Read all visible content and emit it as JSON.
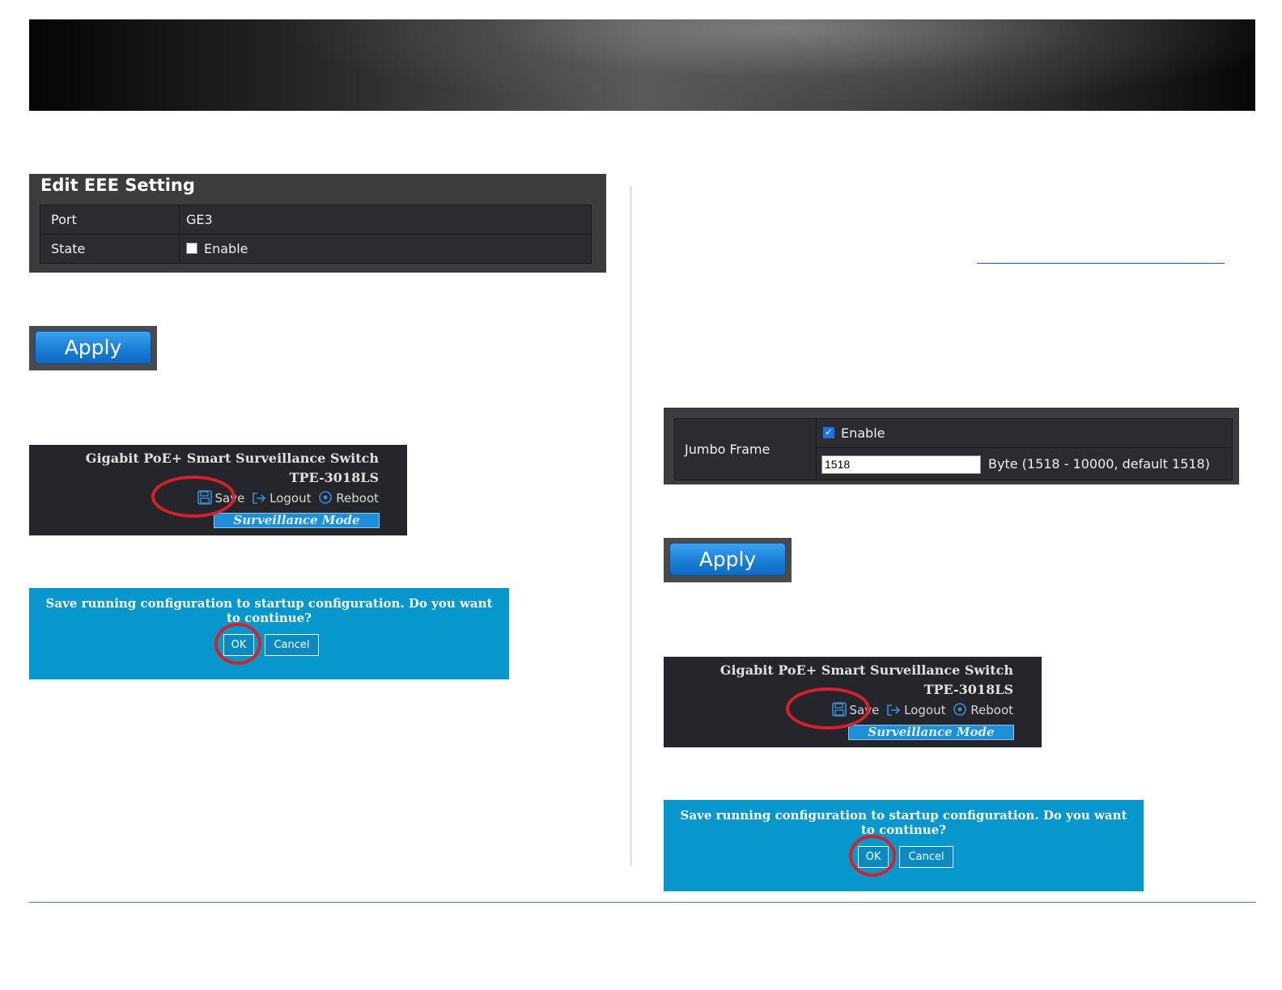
{
  "eee": {
    "title": "Edit EEE Setting",
    "port_label": "Port",
    "port_value": "GE3",
    "state_label": "State",
    "state_option": "Enable",
    "state_checked": false
  },
  "apply_label": "Apply",
  "switch_header": {
    "title": "Gigabit PoE+ Smart Surveillance Switch",
    "model": "TPE-3018LS",
    "save": "Save",
    "logout": "Logout",
    "reboot": "Reboot",
    "mode": "Surveillance Mode"
  },
  "save_dialog": {
    "message": "Save running configuration to startup configuration. Do you want to continue?",
    "ok": "OK",
    "cancel": "Cancel"
  },
  "jumbo": {
    "label": "Jumbo Frame",
    "enable_label": "Enable",
    "enabled": true,
    "value": "1518",
    "hint": "Byte (1518 - 10000, default 1518)"
  },
  "colors": {
    "highlight_ring": "#d8202a",
    "dialog_bg": "#0797cc",
    "apply_blue": "#1b7fd6"
  }
}
